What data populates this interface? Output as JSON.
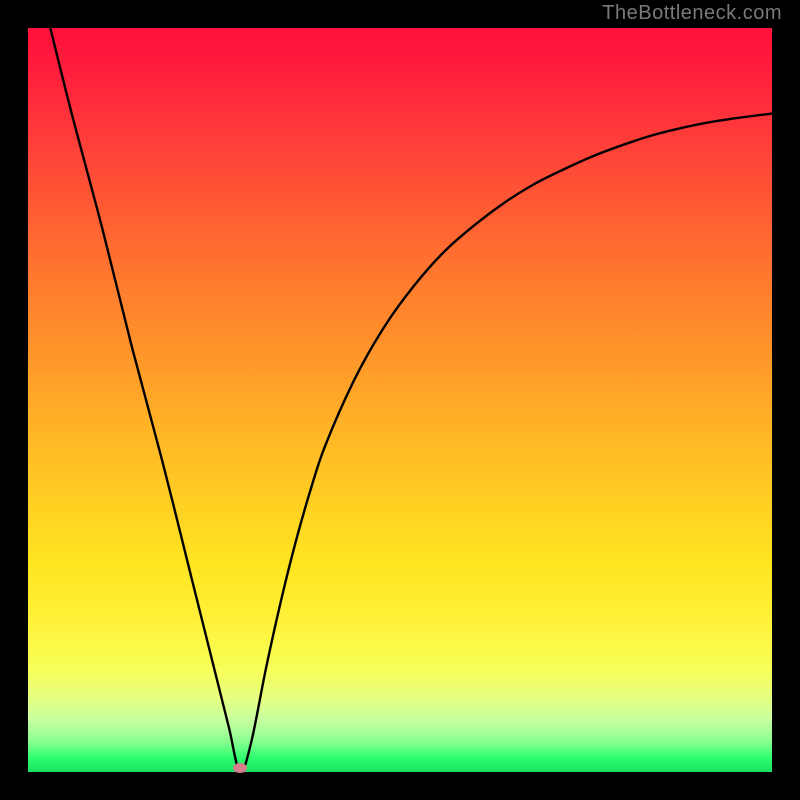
{
  "watermark": "TheBottleneck.com",
  "colors": {
    "background": "#000000",
    "gradient_top": "#ff103a",
    "gradient_bottom": "#18e060",
    "curve": "#000000",
    "marker": "#d67f8a"
  },
  "chart_data": {
    "type": "line",
    "title": "",
    "xlabel": "",
    "ylabel": "",
    "xlim": [
      0,
      100
    ],
    "ylim": [
      0,
      100
    ],
    "grid": false,
    "series": [
      {
        "name": "bottleneck-curve",
        "x": [
          3,
          6,
          10,
          14,
          18,
          22,
          25,
          27,
          28.5,
          30,
          32,
          34,
          36,
          38,
          40,
          44,
          48,
          52,
          56,
          60,
          64,
          68,
          72,
          76,
          80,
          84,
          88,
          92,
          96,
          100
        ],
        "values": [
          100,
          88,
          73,
          57,
          42,
          26,
          14,
          6,
          0,
          4,
          14,
          23,
          31,
          38,
          44,
          53,
          60,
          65.5,
          70,
          73.5,
          76.5,
          79,
          81,
          82.8,
          84.3,
          85.6,
          86.6,
          87.4,
          88,
          88.5
        ]
      }
    ],
    "annotations": [
      {
        "name": "min-point",
        "x": 28.5,
        "y": 0
      }
    ]
  }
}
